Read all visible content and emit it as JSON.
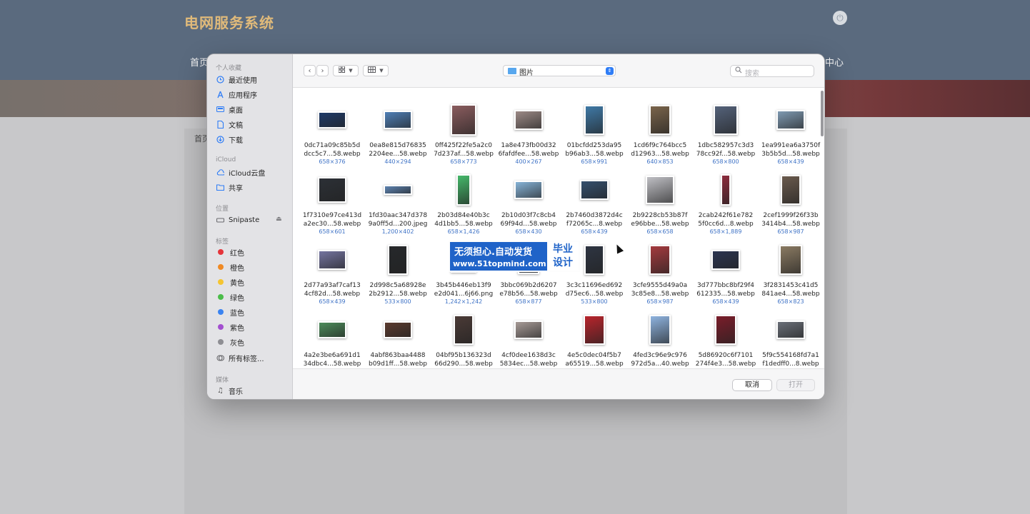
{
  "app": {
    "title": "电网服务系统",
    "nav_home": "首页",
    "nav_center": "中心",
    "breadcrumb": "首页"
  },
  "sidebar": {
    "favorites_title": "个人收藏",
    "favorites": [
      {
        "label": "最近使用",
        "icon": "clock-icon"
      },
      {
        "label": "应用程序",
        "icon": "apps-icon"
      },
      {
        "label": "桌面",
        "icon": "desktop-icon"
      },
      {
        "label": "文稿",
        "icon": "document-icon"
      },
      {
        "label": "下载",
        "icon": "download-icon"
      }
    ],
    "icloud_title": "iCloud",
    "icloud": [
      {
        "label": "iCloud云盘",
        "icon": "cloud-icon"
      },
      {
        "label": "共享",
        "icon": "shared-folder-icon"
      }
    ],
    "locations_title": "位置",
    "locations": [
      {
        "label": "Snipaste",
        "icon": "drive-icon"
      }
    ],
    "tags_title": "标签",
    "tags": [
      {
        "label": "红色",
        "color": "#e5343a"
      },
      {
        "label": "橙色",
        "color": "#f08a24"
      },
      {
        "label": "黄色",
        "color": "#f5c531"
      },
      {
        "label": "绿色",
        "color": "#4bbd4a"
      },
      {
        "label": "蓝色",
        "color": "#3a83f1"
      },
      {
        "label": "紫色",
        "color": "#a34fd0"
      },
      {
        "label": "灰色",
        "color": "#8e8e93"
      },
      {
        "label": "所有标签...",
        "color": ""
      }
    ],
    "media_title": "媒体",
    "media": [
      {
        "label": "音乐",
        "icon": "music-icon"
      }
    ]
  },
  "toolbar": {
    "folder": "图片",
    "search_placeholder": "搜索"
  },
  "files": [
    {
      "l1": "0dc71a09c85b5d",
      "l2": "dcc5c7...58.webp",
      "dims": "658×376",
      "color": "#1e3a68"
    },
    {
      "l1": "0ea8e815d76835",
      "l2": "2204ee...58.webp",
      "dims": "440×294",
      "color": "#4f7fb6"
    },
    {
      "l1": "0ff425f22fe5a2c0",
      "l2": "7d237af...58.webp",
      "dims": "658×773",
      "color": "#8a5c5e"
    },
    {
      "l1": "1a8e473fb00d32",
      "l2": "6fafdfee...58.webp",
      "dims": "400×267",
      "color": "#9c8a86"
    },
    {
      "l1": "01bcfdd253da95",
      "l2": "b96ab3...58.webp",
      "dims": "658×991",
      "color": "#3f79a6"
    },
    {
      "l1": "1cd6f9c764bcc5",
      "l2": "d12963...58.webp",
      "dims": "640×853",
      "color": "#7a644b"
    },
    {
      "l1": "1dbc582957c3d3",
      "l2": "78cc92f...58.webp",
      "dims": "658×800",
      "color": "#54627a"
    },
    {
      "l1": "1ea991ea6a3750f",
      "l2": "3b5b5d...58.webp",
      "dims": "658×439",
      "color": "#7f9ab2"
    },
    {
      "l1": "1f7310e97ce413d",
      "l2": "a2ec30...58.webp",
      "dims": "658×601",
      "color": "#2c3036"
    },
    {
      "l1": "1fd30aac347d378",
      "l2": "9a0ff5d...200.jpeg",
      "dims": "1,200×402",
      "color": "#5d83b0"
    },
    {
      "l1": "2b03d84e40b3c",
      "l2": "4d1bb5...58.webp",
      "dims": "658×1,426",
      "color": "#45b86a"
    },
    {
      "l1": "2b10d03f7c8cb4",
      "l2": "69f94d...58.webp",
      "dims": "658×430",
      "color": "#86b3d7"
    },
    {
      "l1": "2b7460d3872d4c",
      "l2": "f72065c...8.webp",
      "dims": "658×439",
      "color": "#35506e"
    },
    {
      "l1": "2b9228cb53b87f",
      "l2": "e96bbe...58.webp",
      "dims": "658×658",
      "color": "#bfbfc4"
    },
    {
      "l1": "2cab242f61e782",
      "l2": "5f0cc6d...8.webp",
      "dims": "658×1,889",
      "color": "#8c2c3d"
    },
    {
      "l1": "2cef1999f26f33b",
      "l2": "3414b4...58.webp",
      "dims": "658×987",
      "color": "#6a5a4d"
    },
    {
      "l1": "2d77a93af7caf13",
      "l2": "4cf82d...58.webp",
      "dims": "658×439",
      "color": "#7474a0"
    },
    {
      "l1": "2d998c5a68928e",
      "l2": "2b2912...58.webp",
      "dims": "533×800",
      "color": "#26282b"
    },
    {
      "l1": "3b45b446eb13f9",
      "l2": "e2d041...6j66.png",
      "dims": "1,242×1,242",
      "color": "#d3d5da"
    },
    {
      "l1": "3bbc069b2d6207",
      "l2": "e78b56...58.webp",
      "dims": "658×877",
      "color": "#5b6878"
    },
    {
      "l1": "3c3c11696ed692",
      "l2": "d75ec6...58.webp",
      "dims": "533×800",
      "color": "#2e3542"
    },
    {
      "l1": "3cfe9555d49a0a",
      "l2": "3c85e8...58.webp",
      "dims": "658×987",
      "color": "#a43a3e"
    },
    {
      "l1": "3d777bbc8bf29f4",
      "l2": "612335...58.webp",
      "dims": "658×439",
      "color": "#2b3450"
    },
    {
      "l1": "3f2831453c41d5",
      "l2": "841ae4...58.webp",
      "dims": "658×823",
      "color": "#8a7a62"
    },
    {
      "l1": "4a2e3be6a691d1",
      "l2": "34dbc4...58.webp",
      "dims": "",
      "color": "#4c8c5a"
    },
    {
      "l1": "4abf863baa4488",
      "l2": "b09d1ff...58.webp",
      "dims": "",
      "color": "#5a3a2e"
    },
    {
      "l1": "04bf95b136323d",
      "l2": "66d290...58.webp",
      "dims": "",
      "color": "#4a3a36"
    },
    {
      "l1": "4cf0dee1638d3c",
      "l2": "5834ec...58.webp",
      "dims": "",
      "color": "#a69a96"
    },
    {
      "l1": "4e5c0dec04f5b7",
      "l2": "a65519...58.webp",
      "dims": "",
      "color": "#b8242c"
    },
    {
      "l1": "4fed3c96e9c976",
      "l2": "972d5a...40.webp",
      "dims": "",
      "color": "#8eb3df"
    },
    {
      "l1": "5d86920c6f7101",
      "l2": "274f4e3...58.webp",
      "dims": "",
      "color": "#7a1d2a"
    },
    {
      "l1": "5f9c554168fd7a1",
      "l2": "f1dedff0...8.webp",
      "dims": "",
      "color": "#6a6f78"
    }
  ],
  "buttons": {
    "cancel": "取消",
    "open": "打开"
  },
  "watermark": {
    "line1": "无须担心.自动发货",
    "line2": "www.51topmind.com",
    "right1": "毕业",
    "right2": "设计"
  }
}
